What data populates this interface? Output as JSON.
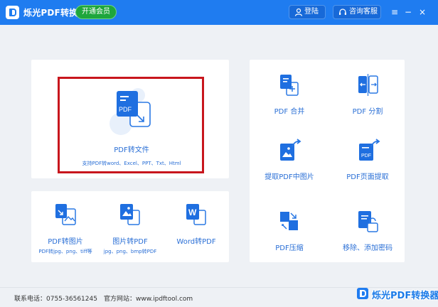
{
  "header": {
    "app_title": "烁光PDF转换器",
    "vip_label": "开通会员",
    "login_label": "登陆",
    "support_label": "咨询客服",
    "menu_glyph": "≡",
    "minimize_glyph": "−",
    "close_glyph": "×"
  },
  "main_tool": {
    "label": "PDF转文件",
    "sub": "支持PDF转word、Excel、PPT、Txt、Html",
    "icon": "pdf-convert-icon"
  },
  "image_tools": [
    {
      "label": "PDF转图片",
      "sub": "PDF转jpg、png、tiff等",
      "icon": "pdf-to-image-icon"
    },
    {
      "label": "图片转PDF",
      "sub": "jpg、png、bmp转PDF",
      "icon": "image-to-pdf-icon"
    },
    {
      "label": "Word转PDF",
      "sub": "",
      "icon": "word-to-pdf-icon"
    }
  ],
  "right_tools": [
    {
      "label": "PDF 合并",
      "icon": "pdf-merge-icon"
    },
    {
      "label": "PDF 分割",
      "icon": "pdf-split-icon"
    },
    {
      "label": "提取PDF中图片",
      "icon": "extract-image-icon"
    },
    {
      "label": "PDF页面提取",
      "icon": "extract-page-icon"
    },
    {
      "label": "PDF压缩",
      "icon": "pdf-compress-icon"
    },
    {
      "label": "移除、添加密码",
      "icon": "password-icon"
    }
  ],
  "footer": {
    "phone": "联系电话：0755-36561245",
    "website": "官方网站：www.ipdftool.com",
    "watermark": "烁光PDF转换器"
  },
  "colors": {
    "brand_blue": "#1f7cf0",
    "vip_green": "#1ea63c",
    "highlight_red": "#c8161d",
    "label_blue": "#2a6fd6"
  }
}
